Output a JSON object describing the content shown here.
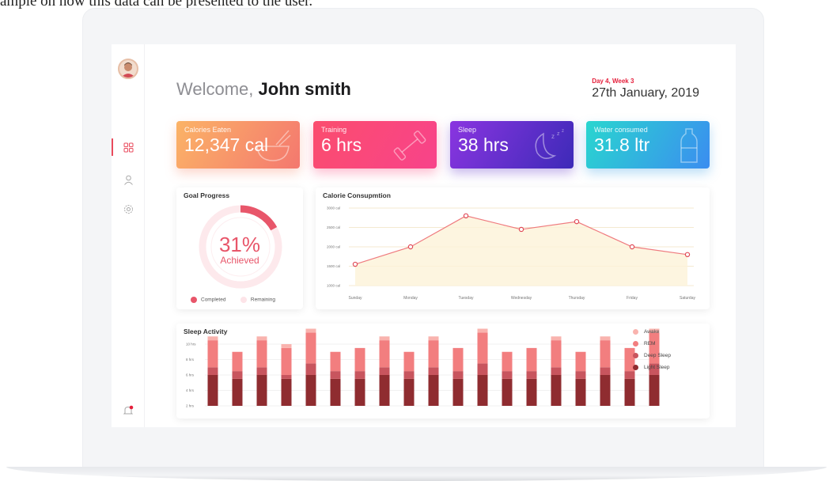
{
  "caption": "ample on how this data can be presented to the user.",
  "header": {
    "welcome_prefix": "Welcome, ",
    "user_name": "John smith",
    "day_week": "Day 4, Week 3",
    "date": "27th January, 2019"
  },
  "stats": [
    {
      "label": "Calories Eaten",
      "value": "12,347 cal",
      "icon": "bowl-icon"
    },
    {
      "label": "Training",
      "value": "6 hrs",
      "icon": "dumbbell-icon"
    },
    {
      "label": "Sleep",
      "value": "38 hrs",
      "icon": "moon-icon"
    },
    {
      "label": "Water consumed",
      "value": "31.8 ltr",
      "icon": "bottle-icon"
    }
  ],
  "goal": {
    "title": "Goal Progress",
    "percent_text": "31%",
    "percent_value": 31,
    "achieved_label": "Achieved",
    "legend_completed": "Completed",
    "legend_remaining": "Remaining"
  },
  "calorie_chart": {
    "title": "Calorie Consupmtion",
    "y_ticks": [
      "3000 cal",
      "2500 cal",
      "2000 cal",
      "1500 cal",
      "1000 cal"
    ],
    "y_tick_values": [
      3000,
      2500,
      2000,
      1500,
      1000
    ]
  },
  "sleep_chart": {
    "title": "Sleep Activity",
    "y_ticks": [
      "10 hrs",
      "8 hrs",
      "6 hrs",
      "4 hrs",
      "2 hrs"
    ],
    "legend": [
      "Awake",
      "REM",
      "Deep Sleep",
      "Light Sleep"
    ]
  },
  "chart_data": [
    {
      "type": "line",
      "title": "Calorie Consupmtion",
      "categories": [
        "Sunday",
        "Monday",
        "Tuesday",
        "Wednesday",
        "Thursday",
        "Friday",
        "Saturday"
      ],
      "values": [
        1550,
        2000,
        2800,
        2450,
        2650,
        2000,
        1800
      ],
      "ylim": [
        1000,
        3000
      ],
      "grid": true
    },
    {
      "type": "bar",
      "title": "Sleep Activity",
      "ylim": [
        2,
        10
      ],
      "series": [
        {
          "name": "Light Sleep",
          "values": [
            4,
            3.5,
            4,
            3.5,
            4,
            3.5,
            3.5,
            4,
            3.5,
            4,
            3.5,
            4,
            3.5,
            3.5,
            4,
            3.5,
            4,
            3.5,
            4
          ]
        },
        {
          "name": "Deep Sleep",
          "values": [
            1,
            1,
            1,
            0.5,
            1.5,
            1,
            1,
            1,
            1,
            1,
            1,
            1.5,
            1,
            1,
            1,
            1,
            1,
            1,
            1.5
          ]
        },
        {
          "name": "REM",
          "values": [
            3.5,
            2.5,
            3.5,
            3.5,
            4,
            2.5,
            3,
            3.5,
            2.5,
            3.5,
            3,
            4,
            2.5,
            3,
            3.5,
            2.5,
            3.5,
            3,
            4
          ]
        },
        {
          "name": "Awake",
          "values": [
            0.5,
            0,
            0.5,
            0.5,
            0.5,
            0,
            0,
            0.5,
            0,
            0.5,
            0,
            0.5,
            0,
            0,
            0.5,
            0,
            0.5,
            0,
            0.5
          ]
        }
      ]
    }
  ],
  "colors": {
    "accent": "#e94a5c",
    "awake": "#f9b3ae",
    "rem": "#f27e7f",
    "deep": "#c8555e",
    "light": "#8f2c30"
  }
}
